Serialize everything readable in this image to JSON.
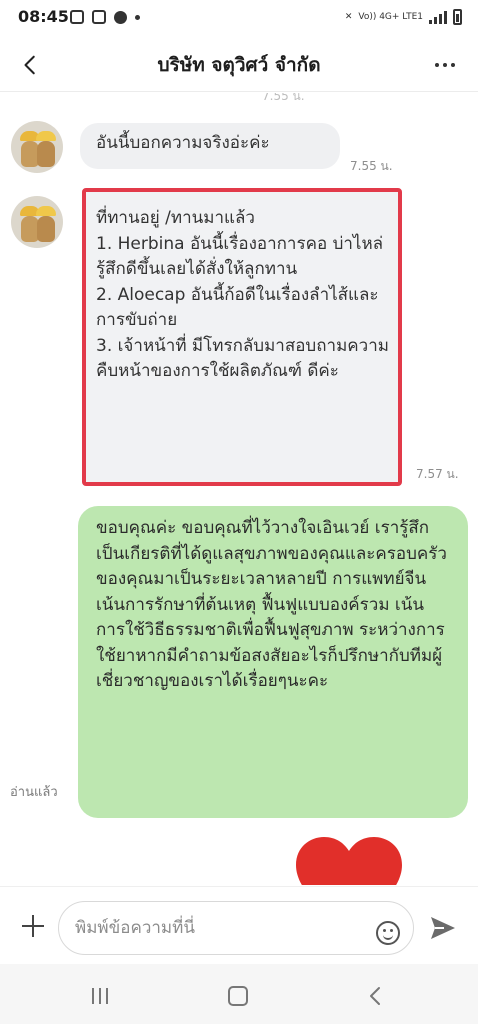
{
  "status_bar": {
    "time": "08:45",
    "network_label": "Vo)) 4G+ LTE1"
  },
  "header": {
    "title": "บริษัท จตุวิศว์ จำกัด"
  },
  "chat": {
    "clipped_time": "7.55 น.",
    "messages": [
      {
        "text": "อันนี้บอกความจริงอ่ะค่ะ",
        "time": "7.55 น."
      },
      {
        "text": "ที่ทานอยู่ /ทานมาแล้ว\n1. Herbina อันนี้เรื่องอาการคอ บ่าไหล่ รู้สึกดีขึ้นเลยได้สั่งให้ลูกทาน\n2. Aloecap อันนี้ก้อดีในเรื่องลำไส้และการขับถ่าย\n3. เจ้าหน้าที่ มีโทรกลับมาสอบถามความคืบหน้าของการใช้ผลิตภัณฑ์ ดีค่ะ",
        "time": "7.57 น."
      }
    ],
    "reply": {
      "text": "ขอบคุณค่ะ ขอบคุณที่ไว้วางใจเอินเวย์ เรารู้สึกเป็นเกียรติที่ได้ดูแลสุขภาพของคุณและครอบครัวของคุณมาเป็นระยะเวลาหลายปี การแพทย์จีนเน้นการรักษาที่ต้นเหตุ ฟื้นฟูแบบองค์รวม เน้นการใช้วิธีธรรมชาติเพื่อฟื้นฟูสุขภาพ ระหว่างการใช้ยาหากมีคำถามข้อสงสัยอะไรก็ปรึกษากับทีมผู้เชี่ยวชาญของเราได้เรื่อยๆนะคะ",
      "read_label": "อ่านแล้ว",
      "bubble_color": "#bde7b0"
    },
    "sticker_icon": "heart-sticker",
    "highlight_color": "#e23a4a"
  },
  "input_bar": {
    "placeholder": "พิมพ์ข้อความที่นี่"
  }
}
